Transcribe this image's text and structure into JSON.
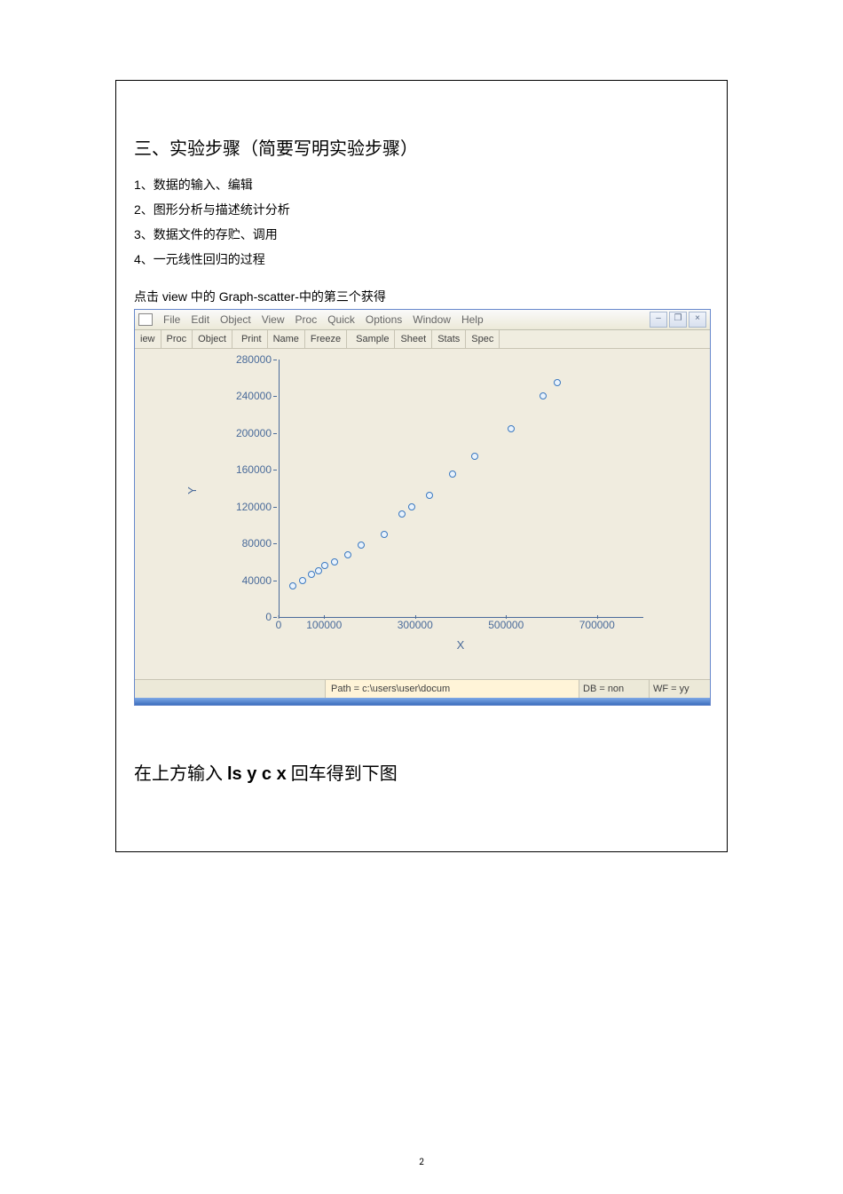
{
  "heading": "三、实验步骤（简要写明实验步骤）",
  "list": [
    "1、数据的输入、编辑",
    "2、图形分析与描述统计分析",
    "3、数据文件的存贮、调用",
    "4、一元线性回归的过程"
  ],
  "instruction_pre": "点击 ",
  "instruction_view": "view",
  "instruction_mid": " 中的 ",
  "instruction_graph": "Graph-scatter-",
  "instruction_post": "中的第三个获得",
  "menu": [
    "File",
    "Edit",
    "Object",
    "View",
    "Proc",
    "Quick",
    "Options",
    "Window",
    "Help"
  ],
  "win_buttons": [
    "–",
    "❐",
    "×"
  ],
  "sub_toolbar": [
    "iew",
    "Proc",
    "Object",
    "Print",
    "Name",
    "Freeze",
    "Sample",
    "Sheet",
    "Stats",
    "Spec"
  ],
  "status": {
    "path": "Path = c:\\users\\user\\docum",
    "db": "DB = non",
    "wf": "WF = yy"
  },
  "chart_data": {
    "type": "scatter",
    "xlabel": "X",
    "ylabel": "Y",
    "x_ticks": [
      0,
      100000,
      300000,
      500000,
      700000
    ],
    "y_ticks": [
      0,
      40000,
      80000,
      120000,
      160000,
      200000,
      240000,
      280000
    ],
    "xlim": [
      0,
      800000
    ],
    "ylim": [
      0,
      280000
    ],
    "points": [
      {
        "x": 30000,
        "y": 34000
      },
      {
        "x": 50000,
        "y": 40000
      },
      {
        "x": 70000,
        "y": 46000
      },
      {
        "x": 85000,
        "y": 50000
      },
      {
        "x": 100000,
        "y": 56000
      },
      {
        "x": 120000,
        "y": 60000
      },
      {
        "x": 150000,
        "y": 68000
      },
      {
        "x": 180000,
        "y": 78000
      },
      {
        "x": 230000,
        "y": 90000
      },
      {
        "x": 270000,
        "y": 112000
      },
      {
        "x": 290000,
        "y": 120000
      },
      {
        "x": 330000,
        "y": 132000
      },
      {
        "x": 380000,
        "y": 155000
      },
      {
        "x": 430000,
        "y": 175000
      },
      {
        "x": 510000,
        "y": 205000
      },
      {
        "x": 580000,
        "y": 240000
      },
      {
        "x": 610000,
        "y": 255000
      }
    ]
  },
  "bottom_pre": "在上方输入 ",
  "bottom_cmd": "ls y c x",
  "bottom_post": " 回车得到下图",
  "page_number": "2"
}
